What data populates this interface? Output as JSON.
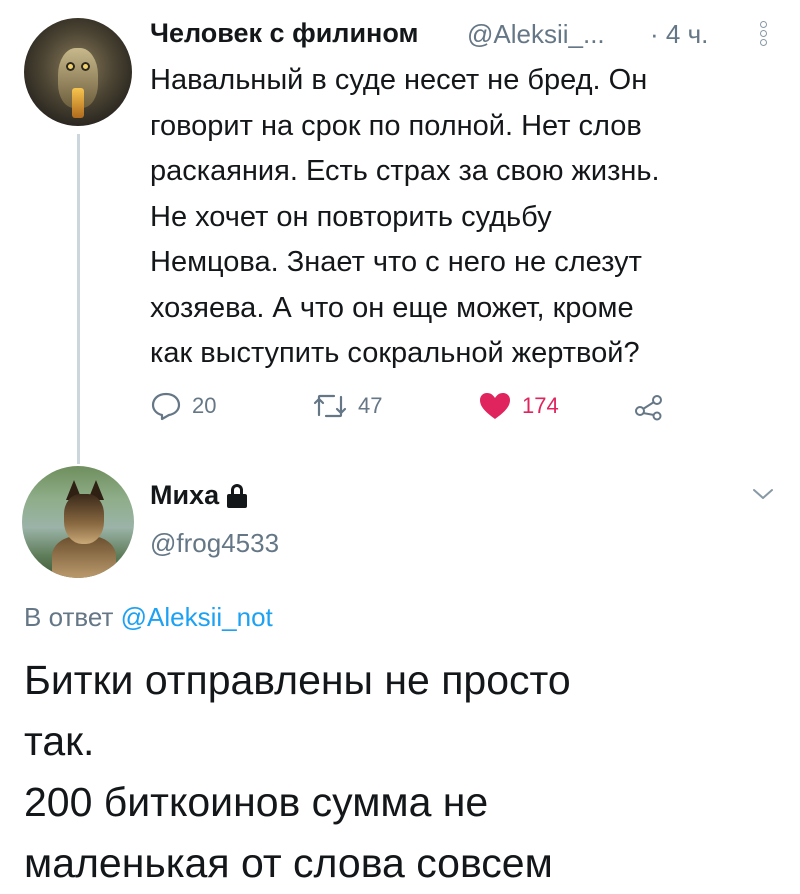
{
  "parent_tweet": {
    "display_name": "Человек с филином",
    "handle": "@Aleksii_...",
    "time": "· 4 ч.",
    "text_lines": [
      "Навальный в суде несет не бред. Он",
      "говорит на срок по полной. Нет слов",
      "раскаяния. Есть страх за свою жизнь.",
      "Не хочет он повторить судьбу",
      "Немцова. Знает что с него не слезут",
      "хозяева. А что он еще может,  кроме",
      "как выступить сокральной жертвой?"
    ],
    "actions": {
      "reply_count": "20",
      "retweet_count": "47",
      "like_count": "174"
    },
    "colors": {
      "like": "#e0245e",
      "muted": "#657786"
    }
  },
  "reply_tweet": {
    "display_name": "Миха",
    "handle": "@frog4533",
    "reply_prefix": "В ответ",
    "reply_mention": "@Aleksii_not",
    "text_lines": [
      "Битки отправлены не просто",
      "так.",
      "200 биткоинов сумма не",
      "маленькая от слова совсем"
    ],
    "colors": {
      "mention": "#1da1f2"
    }
  }
}
